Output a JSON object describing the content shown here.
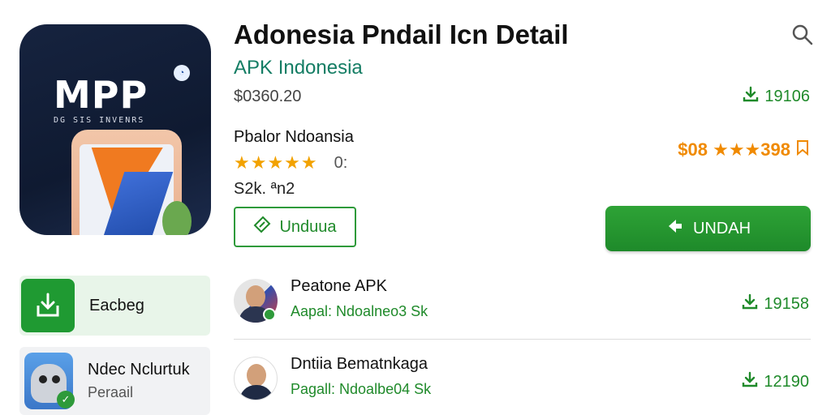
{
  "app": {
    "title": "Adonesia Pndail Icn Detail",
    "developer": "APK Indonesia",
    "price": "$0360.20",
    "category": "Pbalor Ndoansia",
    "stars": "★★★★★",
    "rating_score": "0:",
    "reviews": "S2k. ªn2",
    "downloads": "19106",
    "rating_right": "$08 ★★★398",
    "icon": {
      "logo_text": "MPP",
      "logo_sub": "DG SIS INVENRS"
    }
  },
  "buttons": {
    "unduh_label": "Unduua",
    "install_label": "UNDAH"
  },
  "sidebar": {
    "items": [
      {
        "label": "Eacbeg",
        "icon": "download-box-icon"
      },
      {
        "label": "Ndec Nclurtuk",
        "sublabel": "Peraail",
        "icon": "robot-app-icon"
      }
    ]
  },
  "list": {
    "rows": [
      {
        "title": "Peatone APK",
        "subtitle": "Aapal: Ndoalneo3 Sk",
        "count": "19158"
      },
      {
        "title": "Dntiia Bematnkaga",
        "subtitle": "Pagall: Ndoalbe04 Sk",
        "count": "12190"
      }
    ]
  },
  "colors": {
    "accent_green": "#1f8a2a",
    "install_green": "#2ea336",
    "star_orange": "#f2a200",
    "developer_teal": "#147d64"
  }
}
